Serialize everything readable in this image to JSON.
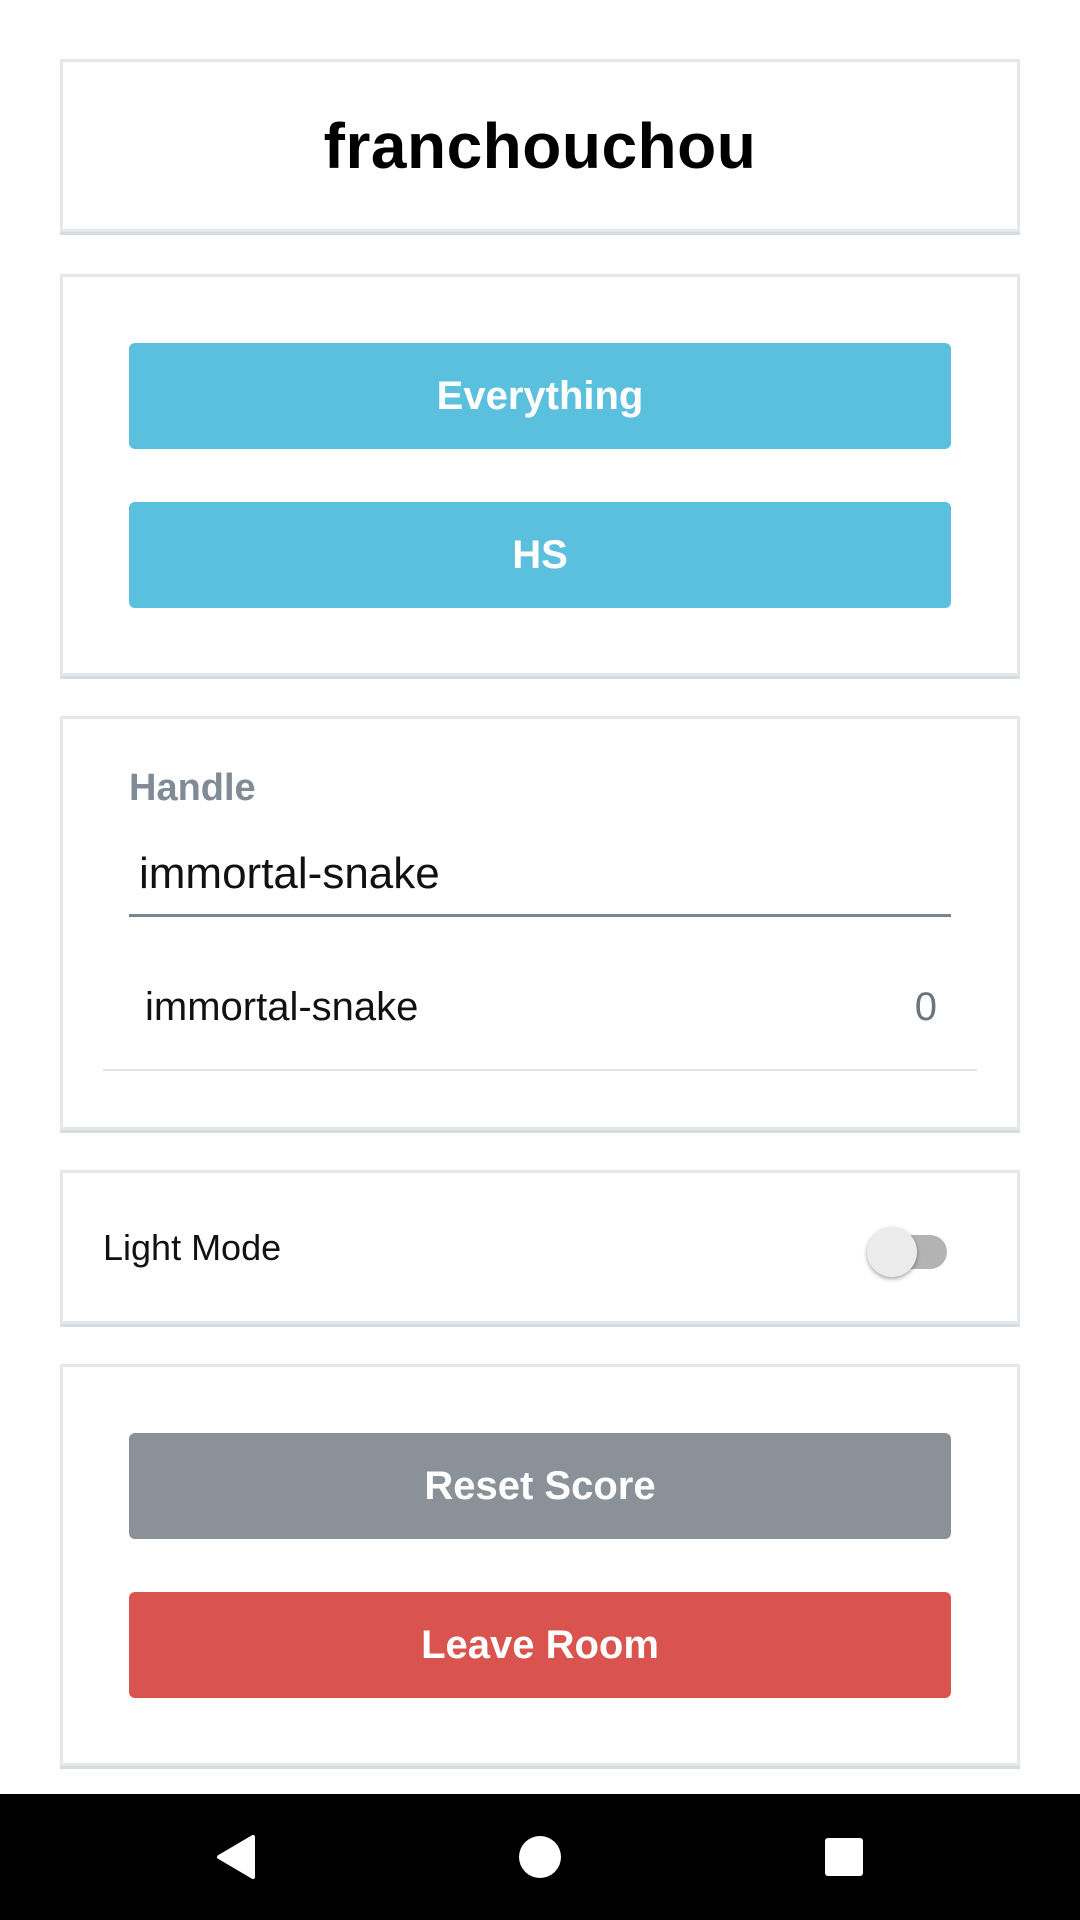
{
  "room": {
    "title": "franchouchou"
  },
  "categories": {
    "buttons": [
      {
        "label": "Everything"
      },
      {
        "label": "HS"
      }
    ],
    "color": "#5bc0de"
  },
  "handle": {
    "label": "Handle",
    "value": "immortal-snake",
    "players": [
      {
        "name": "immortal-snake",
        "score": "0"
      }
    ]
  },
  "settings": {
    "light_mode_label": "Light Mode",
    "light_mode_on": false
  },
  "actions": {
    "reset_label": "Reset Score",
    "leave_label": "Leave Room",
    "reset_color": "#8a9198",
    "leave_color": "#d9534f"
  },
  "navbar": {
    "back_icon": "back-icon",
    "home_icon": "home-icon",
    "recents_icon": "recents-icon"
  }
}
